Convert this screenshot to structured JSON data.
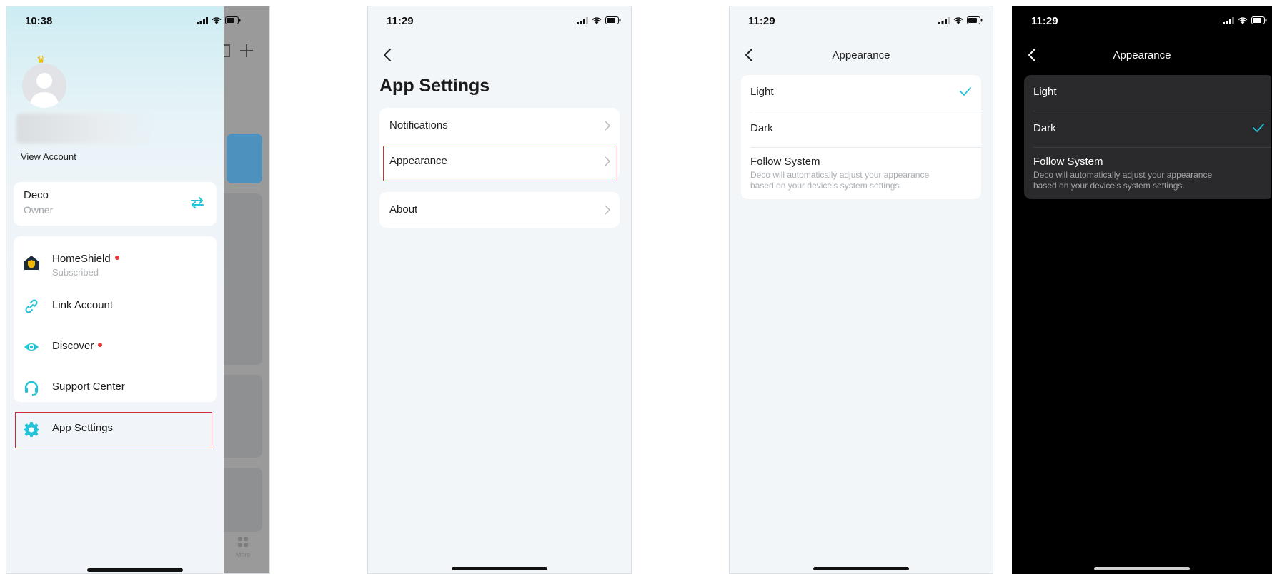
{
  "phone1": {
    "time": "10:38",
    "view_account": "View Account",
    "deco": {
      "name": "Deco",
      "role": "Owner"
    },
    "menu": [
      {
        "label": "HomeShield",
        "sub": "Subscribed",
        "badge": true,
        "icon": "homeshield-icon"
      },
      {
        "label": "Link Account",
        "icon": "link-icon"
      },
      {
        "label": "Discover",
        "badge": true,
        "icon": "eye-icon"
      },
      {
        "label": "Support Center",
        "icon": "headset-icon"
      },
      {
        "label": "App Settings",
        "icon": "gear-icon",
        "highlighted": true
      }
    ],
    "overlay_tab_label": "More"
  },
  "phone2": {
    "time": "11:29",
    "title": "App Settings",
    "items": [
      {
        "label": "Notifications"
      },
      {
        "label": "Appearance",
        "highlighted": true
      },
      {
        "label": "About"
      }
    ]
  },
  "phone3": {
    "time": "11:29",
    "title": "Appearance",
    "theme": "light",
    "options": [
      {
        "label": "Light",
        "selected": true
      },
      {
        "label": "Dark",
        "selected": false
      },
      {
        "label": "Follow System",
        "desc": "Deco will automatically adjust your appearance based on your device's system settings.",
        "selected": false
      }
    ]
  },
  "phone4": {
    "time": "11:29",
    "title": "Appearance",
    "theme": "dark",
    "options": [
      {
        "label": "Light",
        "selected": false
      },
      {
        "label": "Dark",
        "selected": true
      },
      {
        "label": "Follow System",
        "desc": "Deco will automatically adjust your appearance based on your device's system settings.",
        "selected": false
      }
    ]
  },
  "colors": {
    "accent": "#23c3d8",
    "highlight_border": "#d62a36",
    "badge": "#e43838"
  }
}
